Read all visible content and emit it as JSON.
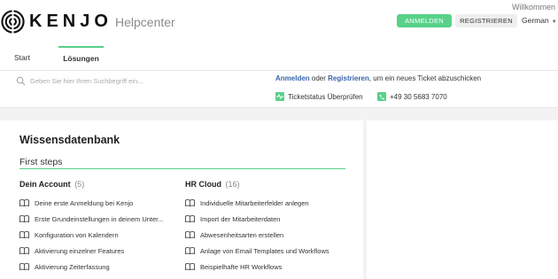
{
  "header": {
    "brand": "KENJO",
    "subtitle": "Helpcenter",
    "welcome": "Willkommen",
    "login_label": "ANMELDEN",
    "register_label": "REGISTRIEREN",
    "language": "German",
    "accent_color": "#58d18a"
  },
  "tabs": [
    {
      "label": "Start",
      "active": false
    },
    {
      "label": "Lösungen",
      "active": true
    }
  ],
  "search": {
    "placeholder": "Geben Sie hier Ihren Suchbegriff ein..."
  },
  "support": {
    "login_link": "Anmelden",
    "or_text": "oder",
    "register_link": "Registrieren",
    "ticket_text": ", um ein neues Ticket abzuschicken",
    "status_link": "Ticketstatus Überprüfen",
    "phone": "+49 30 5683 7070"
  },
  "kb": {
    "title": "Wissensdatenbank",
    "section": "First steps",
    "categories": [
      {
        "name": "Dein Account",
        "count": "(5)",
        "articles": [
          "Deine erste Anmeldung bei Kenjo",
          "Erste Grundeinstellungen in deinem Unter...",
          "Konfiguration von Kalendern",
          "Aktivierung einzelner Features",
          "Aktivierung Zeiterfassung"
        ]
      },
      {
        "name": "HR Cloud",
        "count": "(16)",
        "articles": [
          "Individuelle Mitarbeiterfelder anlegen",
          "Import der Mitarbeiterdaten",
          "Abwesenheitsarten erstellen",
          "Anlage von Email Templates und Workflows",
          "Beispielhafte HR Workflows"
        ]
      }
    ]
  }
}
